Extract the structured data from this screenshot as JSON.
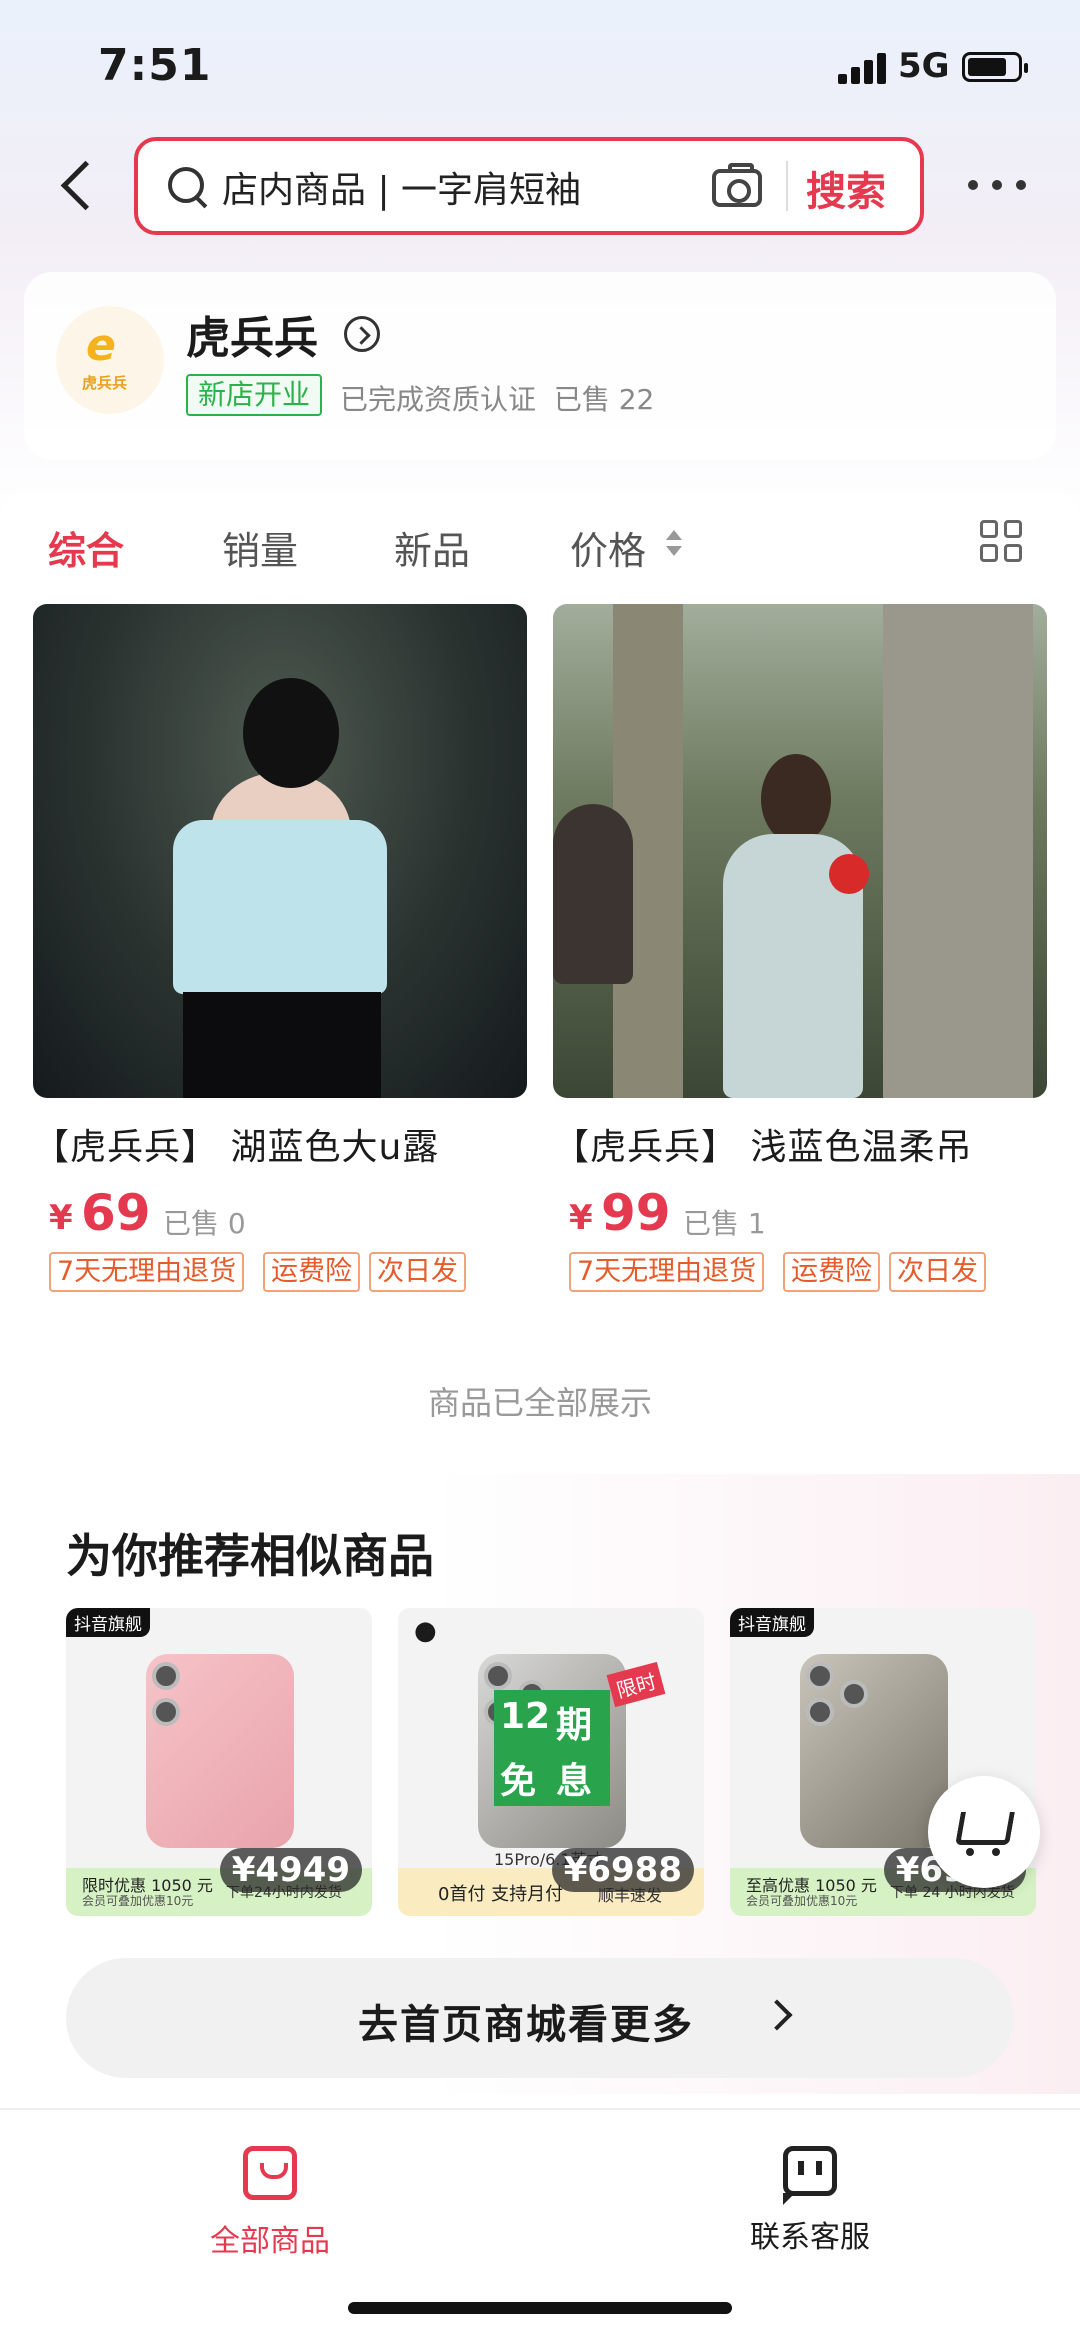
{
  "status_bar": {
    "time": "7:51",
    "network": "5G"
  },
  "header": {
    "search_placeholder": "店内商品 | 一字肩短袖",
    "search_button": "搜索"
  },
  "shop": {
    "logo_text": "虎兵兵",
    "name": "虎兵兵",
    "badge": "新店开业",
    "cert": "已完成资质认证",
    "sold": "已售 22"
  },
  "tabs": [
    "综合",
    "销量",
    "新品",
    "价格"
  ],
  "products": [
    {
      "title": "【虎兵兵】 湖蓝色大u露",
      "price_symbol": "¥",
      "price": "69",
      "sold": "已售 0",
      "badges": [
        "7天无理由退货",
        "运费险",
        "次日发"
      ]
    },
    {
      "title": "【虎兵兵】 浅蓝色温柔吊",
      "price_symbol": "¥",
      "price": "99",
      "sold": "已售 1",
      "badges": [
        "7天无理由退货",
        "运费险",
        "次日发"
      ]
    }
  ],
  "all_shown": "商品已全部展示",
  "recommend": {
    "title": "为你推荐相似商品",
    "items": [
      {
        "tag": "抖音旗舰",
        "price": "¥4949",
        "strip_a": "限时优惠 1050 元",
        "strip_b": "会员可叠加优惠10元",
        "strip_c": "下单24小时内发货"
      },
      {
        "tag": "",
        "promo": [
          "12",
          "期",
          "免",
          "息"
        ],
        "flag": "限时",
        "model": "15Pro/6.1英寸",
        "price": "¥6988",
        "strip_a": "0首付  支持月付",
        "strip_c": "顺丰速发"
      },
      {
        "tag": "抖音旗舰",
        "price": "¥6999",
        "strip_a": "至高优惠 1050 元",
        "strip_b": "会员可叠加优惠10元",
        "strip_c": "下单 24 小时内发货"
      }
    ]
  },
  "home_more": "去首页商城看更多",
  "bottom_nav": {
    "all_products": "全部商品",
    "contact": "联系客服"
  },
  "colors": {
    "accent": "#e5394f",
    "green": "#2bb24c",
    "badge_orange": "#e75a2a"
  },
  "icons": [
    "back-icon",
    "search-icon",
    "camera-icon",
    "more-icon",
    "shop-arrow-icon",
    "sort-icon",
    "grid-view-icon",
    "cart-icon",
    "bag-icon",
    "chat-icon"
  ]
}
